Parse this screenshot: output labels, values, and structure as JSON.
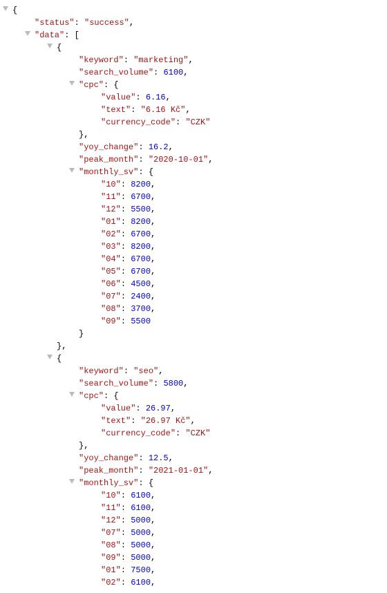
{
  "lines": [
    {
      "indent": 0,
      "tw": true,
      "tokens": [
        {
          "t": "{",
          "c": "p"
        }
      ]
    },
    {
      "indent": 1,
      "tokens": [
        {
          "t": "\"status\"",
          "c": "k"
        },
        {
          "t": ": ",
          "c": "p"
        },
        {
          "t": "\"success\"",
          "c": "k"
        },
        {
          "t": ",",
          "c": "p"
        }
      ]
    },
    {
      "indent": 1,
      "tw": true,
      "tokens": [
        {
          "t": "\"data\"",
          "c": "k"
        },
        {
          "t": ": [",
          "c": "p"
        }
      ]
    },
    {
      "indent": 2,
      "tw": true,
      "tokens": [
        {
          "t": "{",
          "c": "p"
        }
      ]
    },
    {
      "indent": 3,
      "tokens": [
        {
          "t": "\"keyword\"",
          "c": "k"
        },
        {
          "t": ": ",
          "c": "p"
        },
        {
          "t": "\"marketing\"",
          "c": "k"
        },
        {
          "t": ",",
          "c": "p"
        }
      ]
    },
    {
      "indent": 3,
      "tokens": [
        {
          "t": "\"search_volume\"",
          "c": "k"
        },
        {
          "t": ": ",
          "c": "p"
        },
        {
          "t": "6100",
          "c": "n"
        },
        {
          "t": ",",
          "c": "p"
        }
      ]
    },
    {
      "indent": 3,
      "tw": true,
      "tokens": [
        {
          "t": "\"cpc\"",
          "c": "k"
        },
        {
          "t": ": {",
          "c": "p"
        }
      ]
    },
    {
      "indent": 4,
      "tokens": [
        {
          "t": "\"value\"",
          "c": "k"
        },
        {
          "t": ": ",
          "c": "p"
        },
        {
          "t": "6.16",
          "c": "n"
        },
        {
          "t": ",",
          "c": "p"
        }
      ]
    },
    {
      "indent": 4,
      "tokens": [
        {
          "t": "\"text\"",
          "c": "k"
        },
        {
          "t": ": ",
          "c": "p"
        },
        {
          "t": "\"6.16 Kč\"",
          "c": "k"
        },
        {
          "t": ",",
          "c": "p"
        }
      ]
    },
    {
      "indent": 4,
      "tokens": [
        {
          "t": "\"currency_code\"",
          "c": "k"
        },
        {
          "t": ": ",
          "c": "p"
        },
        {
          "t": "\"CZK\"",
          "c": "k"
        }
      ]
    },
    {
      "indent": 3,
      "tokens": [
        {
          "t": "},",
          "c": "p"
        }
      ]
    },
    {
      "indent": 3,
      "tokens": [
        {
          "t": "\"yoy_change\"",
          "c": "k"
        },
        {
          "t": ": ",
          "c": "p"
        },
        {
          "t": "16.2",
          "c": "n"
        },
        {
          "t": ",",
          "c": "p"
        }
      ]
    },
    {
      "indent": 3,
      "tokens": [
        {
          "t": "\"peak_month\"",
          "c": "k"
        },
        {
          "t": ": ",
          "c": "p"
        },
        {
          "t": "\"2020-10-01\"",
          "c": "k"
        },
        {
          "t": ",",
          "c": "p"
        }
      ]
    },
    {
      "indent": 3,
      "tw": true,
      "tokens": [
        {
          "t": "\"monthly_sv\"",
          "c": "k"
        },
        {
          "t": ": {",
          "c": "p"
        }
      ]
    },
    {
      "indent": 4,
      "tokens": [
        {
          "t": "\"10\"",
          "c": "k"
        },
        {
          "t": ": ",
          "c": "p"
        },
        {
          "t": "8200",
          "c": "n"
        },
        {
          "t": ",",
          "c": "p"
        }
      ]
    },
    {
      "indent": 4,
      "tokens": [
        {
          "t": "\"11\"",
          "c": "k"
        },
        {
          "t": ": ",
          "c": "p"
        },
        {
          "t": "6700",
          "c": "n"
        },
        {
          "t": ",",
          "c": "p"
        }
      ]
    },
    {
      "indent": 4,
      "tokens": [
        {
          "t": "\"12\"",
          "c": "k"
        },
        {
          "t": ": ",
          "c": "p"
        },
        {
          "t": "5500",
          "c": "n"
        },
        {
          "t": ",",
          "c": "p"
        }
      ]
    },
    {
      "indent": 4,
      "tokens": [
        {
          "t": "\"01\"",
          "c": "k"
        },
        {
          "t": ": ",
          "c": "p"
        },
        {
          "t": "8200",
          "c": "n"
        },
        {
          "t": ",",
          "c": "p"
        }
      ]
    },
    {
      "indent": 4,
      "tokens": [
        {
          "t": "\"02\"",
          "c": "k"
        },
        {
          "t": ": ",
          "c": "p"
        },
        {
          "t": "6700",
          "c": "n"
        },
        {
          "t": ",",
          "c": "p"
        }
      ]
    },
    {
      "indent": 4,
      "tokens": [
        {
          "t": "\"03\"",
          "c": "k"
        },
        {
          "t": ": ",
          "c": "p"
        },
        {
          "t": "8200",
          "c": "n"
        },
        {
          "t": ",",
          "c": "p"
        }
      ]
    },
    {
      "indent": 4,
      "tokens": [
        {
          "t": "\"04\"",
          "c": "k"
        },
        {
          "t": ": ",
          "c": "p"
        },
        {
          "t": "6700",
          "c": "n"
        },
        {
          "t": ",",
          "c": "p"
        }
      ]
    },
    {
      "indent": 4,
      "tokens": [
        {
          "t": "\"05\"",
          "c": "k"
        },
        {
          "t": ": ",
          "c": "p"
        },
        {
          "t": "6700",
          "c": "n"
        },
        {
          "t": ",",
          "c": "p"
        }
      ]
    },
    {
      "indent": 4,
      "tokens": [
        {
          "t": "\"06\"",
          "c": "k"
        },
        {
          "t": ": ",
          "c": "p"
        },
        {
          "t": "4500",
          "c": "n"
        },
        {
          "t": ",",
          "c": "p"
        }
      ]
    },
    {
      "indent": 4,
      "tokens": [
        {
          "t": "\"07\"",
          "c": "k"
        },
        {
          "t": ": ",
          "c": "p"
        },
        {
          "t": "2400",
          "c": "n"
        },
        {
          "t": ",",
          "c": "p"
        }
      ]
    },
    {
      "indent": 4,
      "tokens": [
        {
          "t": "\"08\"",
          "c": "k"
        },
        {
          "t": ": ",
          "c": "p"
        },
        {
          "t": "3700",
          "c": "n"
        },
        {
          "t": ",",
          "c": "p"
        }
      ]
    },
    {
      "indent": 4,
      "tokens": [
        {
          "t": "\"09\"",
          "c": "k"
        },
        {
          "t": ": ",
          "c": "p"
        },
        {
          "t": "5500",
          "c": "n"
        }
      ]
    },
    {
      "indent": 3,
      "tokens": [
        {
          "t": "}",
          "c": "p"
        }
      ]
    },
    {
      "indent": 2,
      "tokens": [
        {
          "t": "},",
          "c": "p"
        }
      ]
    },
    {
      "indent": 2,
      "tw": true,
      "tokens": [
        {
          "t": "{",
          "c": "p"
        }
      ]
    },
    {
      "indent": 3,
      "tokens": [
        {
          "t": "\"keyword\"",
          "c": "k"
        },
        {
          "t": ": ",
          "c": "p"
        },
        {
          "t": "\"seo\"",
          "c": "k"
        },
        {
          "t": ",",
          "c": "p"
        }
      ]
    },
    {
      "indent": 3,
      "tokens": [
        {
          "t": "\"search_volume\"",
          "c": "k"
        },
        {
          "t": ": ",
          "c": "p"
        },
        {
          "t": "5800",
          "c": "n"
        },
        {
          "t": ",",
          "c": "p"
        }
      ]
    },
    {
      "indent": 3,
      "tw": true,
      "tokens": [
        {
          "t": "\"cpc\"",
          "c": "k"
        },
        {
          "t": ": {",
          "c": "p"
        }
      ]
    },
    {
      "indent": 4,
      "tokens": [
        {
          "t": "\"value\"",
          "c": "k"
        },
        {
          "t": ": ",
          "c": "p"
        },
        {
          "t": "26.97",
          "c": "n"
        },
        {
          "t": ",",
          "c": "p"
        }
      ]
    },
    {
      "indent": 4,
      "tokens": [
        {
          "t": "\"text\"",
          "c": "k"
        },
        {
          "t": ": ",
          "c": "p"
        },
        {
          "t": "\"26.97 Kč\"",
          "c": "k"
        },
        {
          "t": ",",
          "c": "p"
        }
      ]
    },
    {
      "indent": 4,
      "tokens": [
        {
          "t": "\"currency_code\"",
          "c": "k"
        },
        {
          "t": ": ",
          "c": "p"
        },
        {
          "t": "\"CZK\"",
          "c": "k"
        }
      ]
    },
    {
      "indent": 3,
      "tokens": [
        {
          "t": "},",
          "c": "p"
        }
      ]
    },
    {
      "indent": 3,
      "tokens": [
        {
          "t": "\"yoy_change\"",
          "c": "k"
        },
        {
          "t": ": ",
          "c": "p"
        },
        {
          "t": "12.5",
          "c": "n"
        },
        {
          "t": ",",
          "c": "p"
        }
      ]
    },
    {
      "indent": 3,
      "tokens": [
        {
          "t": "\"peak_month\"",
          "c": "k"
        },
        {
          "t": ": ",
          "c": "p"
        },
        {
          "t": "\"2021-01-01\"",
          "c": "k"
        },
        {
          "t": ",",
          "c": "p"
        }
      ]
    },
    {
      "indent": 3,
      "tw": true,
      "tokens": [
        {
          "t": "\"monthly_sv\"",
          "c": "k"
        },
        {
          "t": ": {",
          "c": "p"
        }
      ]
    },
    {
      "indent": 4,
      "tokens": [
        {
          "t": "\"10\"",
          "c": "k"
        },
        {
          "t": ": ",
          "c": "p"
        },
        {
          "t": "6100",
          "c": "n"
        },
        {
          "t": ",",
          "c": "p"
        }
      ]
    },
    {
      "indent": 4,
      "tokens": [
        {
          "t": "\"11\"",
          "c": "k"
        },
        {
          "t": ": ",
          "c": "p"
        },
        {
          "t": "6100",
          "c": "n"
        },
        {
          "t": ",",
          "c": "p"
        }
      ]
    },
    {
      "indent": 4,
      "tokens": [
        {
          "t": "\"12\"",
          "c": "k"
        },
        {
          "t": ": ",
          "c": "p"
        },
        {
          "t": "5000",
          "c": "n"
        },
        {
          "t": ",",
          "c": "p"
        }
      ]
    },
    {
      "indent": 4,
      "tokens": [
        {
          "t": "\"07\"",
          "c": "k"
        },
        {
          "t": ": ",
          "c": "p"
        },
        {
          "t": "5000",
          "c": "n"
        },
        {
          "t": ",",
          "c": "p"
        }
      ]
    },
    {
      "indent": 4,
      "tokens": [
        {
          "t": "\"08\"",
          "c": "k"
        },
        {
          "t": ": ",
          "c": "p"
        },
        {
          "t": "5000",
          "c": "n"
        },
        {
          "t": ",",
          "c": "p"
        }
      ]
    },
    {
      "indent": 4,
      "tokens": [
        {
          "t": "\"09\"",
          "c": "k"
        },
        {
          "t": ": ",
          "c": "p"
        },
        {
          "t": "5000",
          "c": "n"
        },
        {
          "t": ",",
          "c": "p"
        }
      ]
    },
    {
      "indent": 4,
      "tokens": [
        {
          "t": "\"01\"",
          "c": "k"
        },
        {
          "t": ": ",
          "c": "p"
        },
        {
          "t": "7500",
          "c": "n"
        },
        {
          "t": ",",
          "c": "p"
        }
      ]
    },
    {
      "indent": 4,
      "tokens": [
        {
          "t": "\"02\"",
          "c": "k"
        },
        {
          "t": ": ",
          "c": "p"
        },
        {
          "t": "6100",
          "c": "n"
        },
        {
          "t": ",",
          "c": "p"
        }
      ]
    }
  ]
}
